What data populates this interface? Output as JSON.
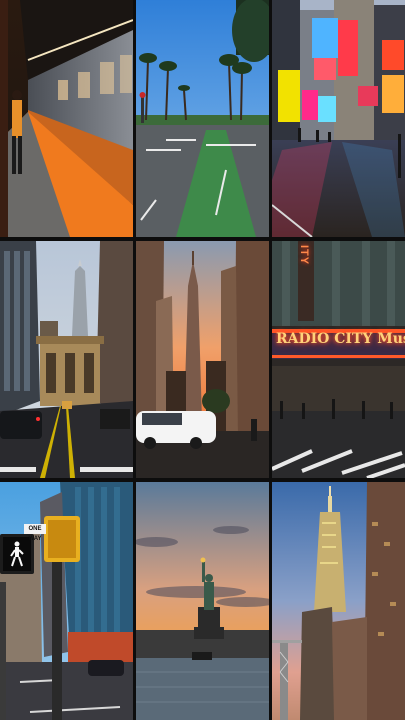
{
  "grid": {
    "tiles": [
      {
        "id": "subway-platform",
        "depicts": "subway train at platform with orange edge"
      },
      {
        "id": "palm-street",
        "depicts": "palm-lined street with green bike lane"
      },
      {
        "id": "times-square",
        "depicts": "times square billboards on wet street"
      },
      {
        "id": "grand-central",
        "depicts": "grand central terminal and chrysler building"
      },
      {
        "id": "empire-sunset",
        "depicts": "empire state building at sunset with white car"
      },
      {
        "id": "radio-city",
        "depicts": "radio city music hall marquee"
      },
      {
        "id": "walk-signal",
        "depicts": "pedestrian walk signal and street"
      },
      {
        "id": "statue-liberty",
        "depicts": "statue of liberty silhouette at sunset"
      },
      {
        "id": "empire-dusk",
        "depicts": "empire state building lit at dusk"
      }
    ]
  },
  "signs": {
    "radio_city_marquee": "RADIO CITY Music",
    "radio_city_vertical": "ITY",
    "street_sign": "ONE WAY"
  },
  "colors": {
    "gap": "#0d0d0d",
    "subway_orange": "#f07a1e",
    "sunset_orange": "#f08a3a",
    "neon_red": "#ff3a1a"
  }
}
